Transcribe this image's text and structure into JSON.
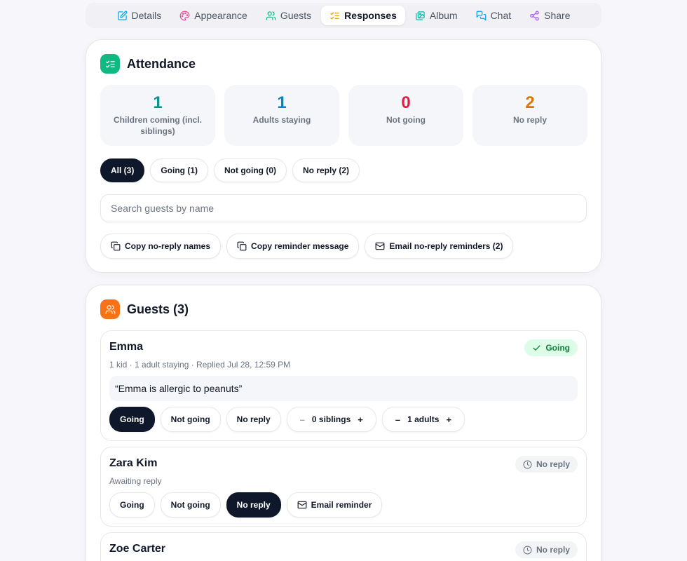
{
  "tabs": [
    {
      "label": "Details",
      "icon": "edit-icon",
      "color": "#0ea5e9"
    },
    {
      "label": "Appearance",
      "icon": "palette-icon",
      "color": "#ec4899"
    },
    {
      "label": "Guests",
      "icon": "users-icon",
      "color": "#10b981"
    },
    {
      "label": "Responses",
      "icon": "list-check-icon",
      "color": "#f59e0b",
      "active": true
    },
    {
      "label": "Album",
      "icon": "images-icon",
      "color": "#14b8a6"
    },
    {
      "label": "Chat",
      "icon": "chat-icon",
      "color": "#0ea5e9"
    },
    {
      "label": "Share",
      "icon": "share-icon",
      "color": "#a855f7"
    }
  ],
  "attendance": {
    "title": "Attendance",
    "icon_color": "#10b981",
    "stats": [
      {
        "value": "1",
        "label": "Children coming (incl. siblings)",
        "color": "#0d9488"
      },
      {
        "value": "1",
        "label": "Adults staying",
        "color": "#0284c7"
      },
      {
        "value": "0",
        "label": "Not going",
        "color": "#e11d48"
      },
      {
        "value": "2",
        "label": "No reply",
        "color": "#d97706"
      }
    ],
    "filters": [
      "All (3)",
      "Going (1)",
      "Not going (0)",
      "No reply (2)"
    ],
    "active_filter": 0,
    "search_placeholder": "Search guests by name",
    "actions": [
      {
        "label": "Copy no-reply names",
        "icon": "copy-icon"
      },
      {
        "label": "Copy reminder message",
        "icon": "copy-icon"
      },
      {
        "label": "Email no-reply reminders (2)",
        "icon": "mail-icon"
      }
    ]
  },
  "guests": {
    "title": "Guests (3)",
    "icon_color": "#f97316",
    "list": [
      {
        "name": "Emma",
        "meta": "1 kid · 1 adult staying · Replied Jul 28, 12:59 PM",
        "status": "Going",
        "status_icon": "check-icon",
        "note": "“Emma is allergic to peanuts”",
        "buttons": [
          "Going",
          "Not going",
          "No reply"
        ],
        "selected": "Going",
        "siblings": "0 siblings",
        "adults": "1 adults",
        "minus": "–",
        "plus": "+"
      },
      {
        "name": "Zara Kim",
        "meta": "Awaiting reply",
        "status": "No reply",
        "status_icon": "clock-icon",
        "buttons": [
          "Going",
          "Not going",
          "No reply"
        ],
        "selected": "No reply",
        "reminder": "Email reminder"
      },
      {
        "name": "Zoe Carter",
        "status": "No reply",
        "status_icon": "clock-icon"
      }
    ]
  },
  "colors": {
    "going_bg": "#dcfce7",
    "going_text": "#15803d",
    "noreply_bg": "#f3f4f6",
    "noreply_text": "#6b7280",
    "dark": "#0f172a"
  }
}
